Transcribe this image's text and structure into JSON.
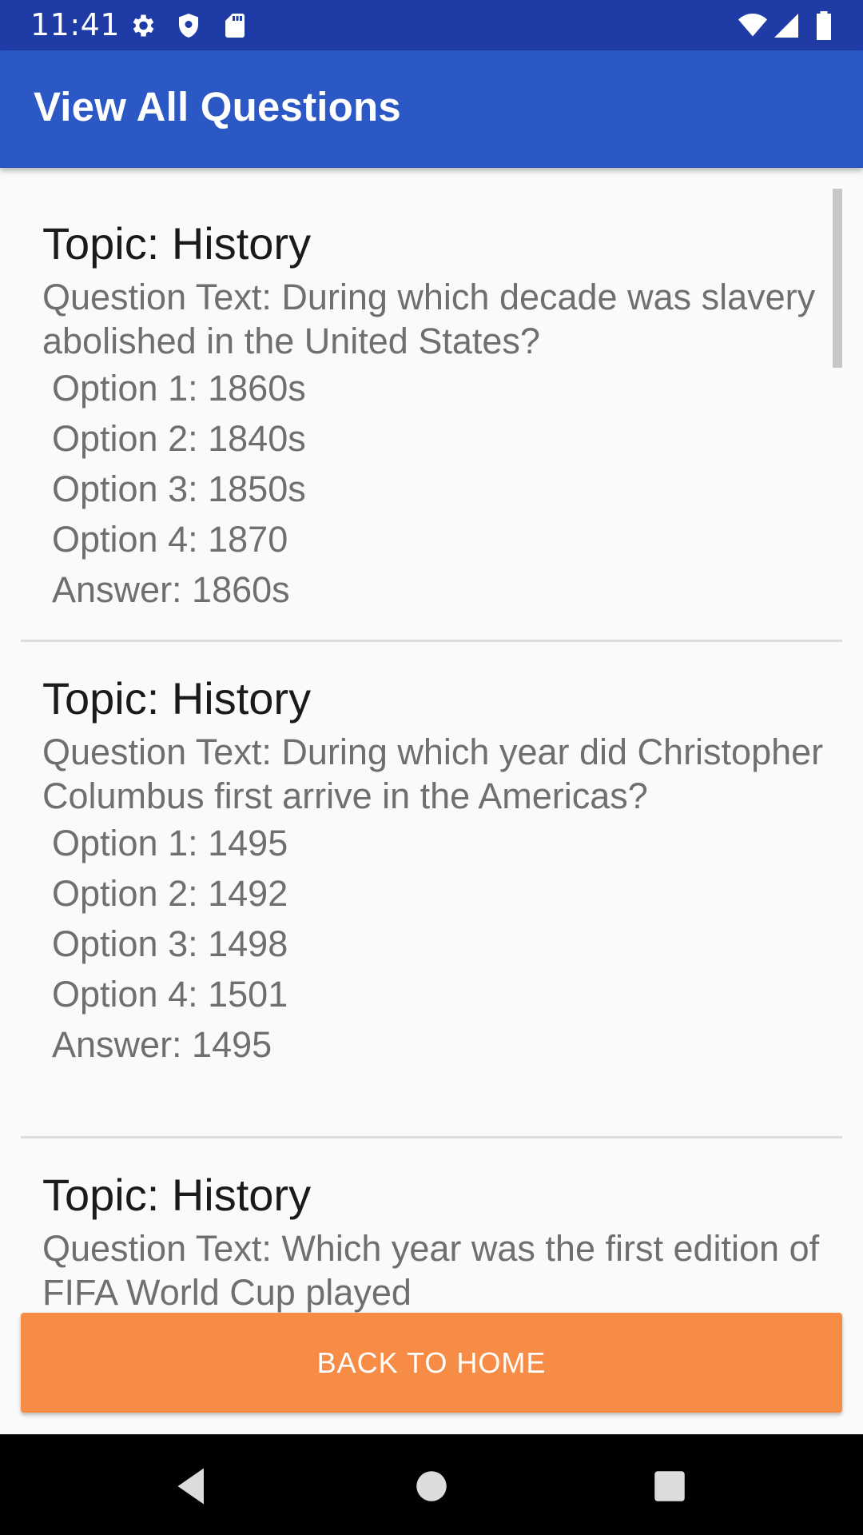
{
  "status_bar": {
    "time": "11:41",
    "icons_left": [
      "gear-icon",
      "shield-icon",
      "sd-card-icon"
    ],
    "icons_right": [
      "wifi-icon",
      "signal-icon",
      "battery-icon"
    ]
  },
  "app_bar": {
    "title": "View All Questions"
  },
  "questions": [
    {
      "topic": "Topic: History",
      "question": "Question Text: During which decade was slavery abolished in the United States?",
      "option1": " Option 1: 1860s",
      "option2": " Option 2: 1840s",
      "option3": " Option 3: 1850s",
      "option4": " Option 4: 1870",
      "answer": " Answer: 1860s"
    },
    {
      "topic": "Topic: History",
      "question": "Question Text: During which year did Christopher Columbus first arrive in the Americas?",
      "option1": " Option 1: 1495",
      "option2": " Option 2: 1492",
      "option3": " Option 3: 1498",
      "option4": " Option 4: 1501",
      "answer": " Answer: 1495"
    },
    {
      "topic": "Topic: History",
      "question": "Question Text: Which year was the first edition of FIFA World Cup played"
    }
  ],
  "back_button": {
    "label": "BACK TO HOME"
  },
  "nav_bar": {
    "icons": [
      "back-triangle-icon",
      "home-circle-icon",
      "recents-square-icon"
    ]
  },
  "colors": {
    "status_bar": "#1e3ba6",
    "app_bar": "#2b58c4",
    "button": "#f68c45",
    "background": "#fafafa"
  }
}
